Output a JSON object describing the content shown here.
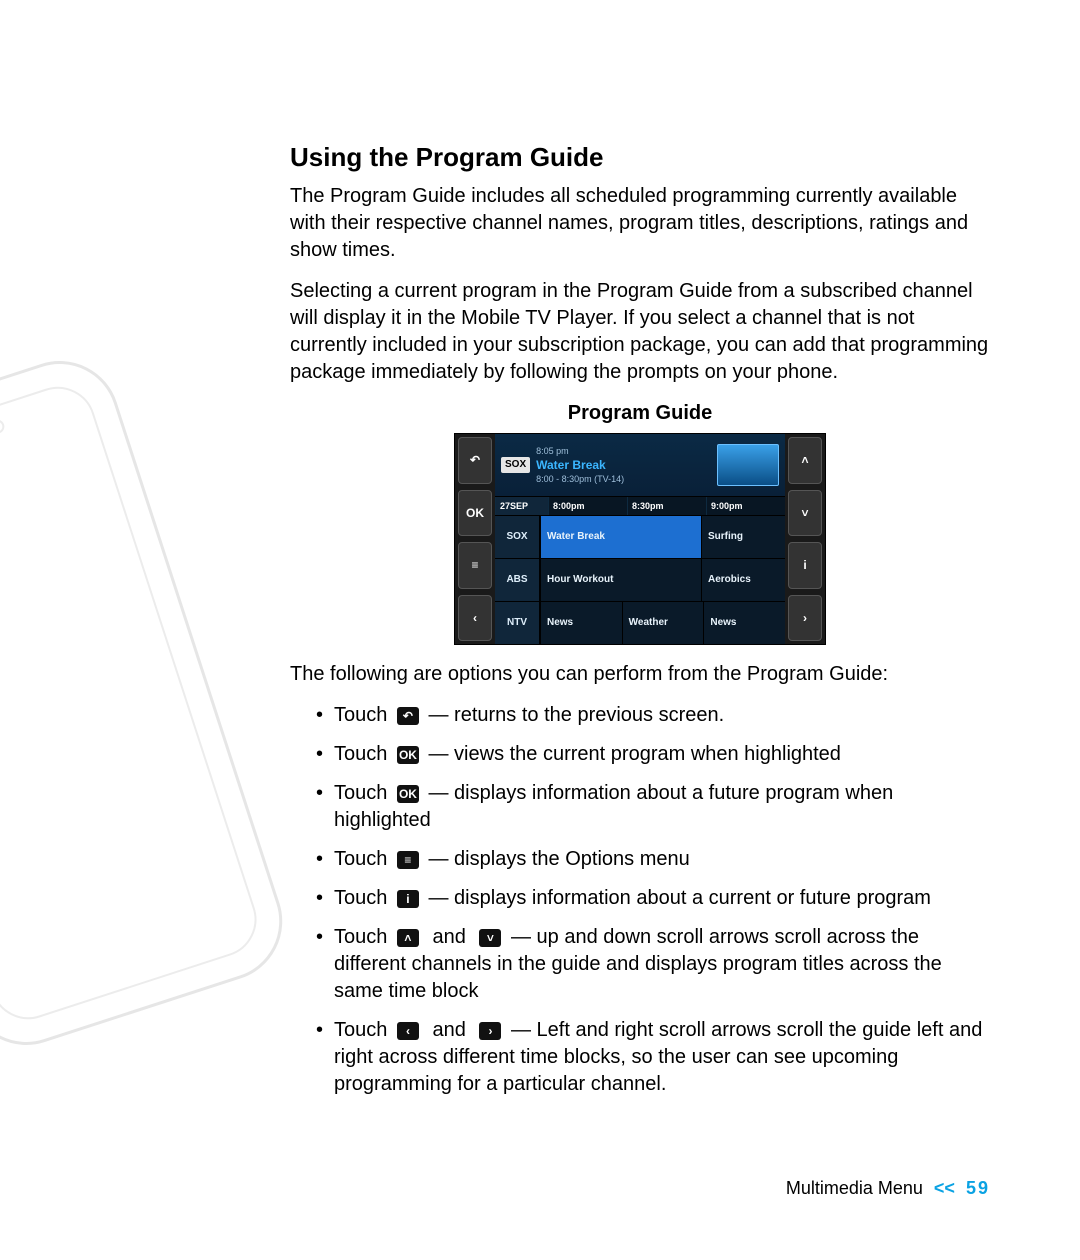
{
  "heading": "Using the Program Guide",
  "para1": "The Program Guide includes all scheduled programming currently available with their respective channel names, program titles, descriptions, ratings and show times.",
  "para2": "Selecting a current program in the Program Guide from a subscribed channel will display it in the Mobile TV Player.  If you select a channel that is not currently included in your subscription package, you can add that programming package immediately by following the prompts on your phone.",
  "caption": "Program Guide",
  "screenshot": {
    "clock": "8:05 pm",
    "channel_tag": "SOX",
    "title": "Water Break",
    "subtitle": "8:00 - 8:30pm (TV-14)",
    "date_label": "27SEP",
    "times": [
      "8:00pm",
      "8:30pm",
      "9:00pm"
    ],
    "left_buttons": [
      "↶",
      "OK",
      "≡",
      "‹"
    ],
    "right_buttons": [
      "˄",
      "˅",
      "i",
      "›"
    ],
    "rows": [
      {
        "ch": "SOX",
        "cells": [
          "Water Break",
          "Surfing"
        ],
        "selected": 0
      },
      {
        "ch": "ABS",
        "cells": [
          "Hour Workout",
          "Aerobics"
        ]
      },
      {
        "ch": "NTV",
        "cells": [
          "News",
          "Weather",
          "News"
        ]
      }
    ]
  },
  "options_intro": "The following are options you can perform from the Program Guide:",
  "touch_word": "Touch",
  "and_word": "and",
  "bullets": {
    "b1": " — returns to the previous screen.",
    "b2": " — views the current program when highlighted",
    "b3": " — displays information about a future program when highlighted",
    "b4": " — displays the Options menu",
    "b5": " — displays information about a current or future program",
    "b6": " — up and down scroll arrows scroll across the different channels in the guide and displays program titles across the same time block",
    "b7": " — Left and right scroll arrows scroll the guide left and right across different time blocks, so the user can see upcoming programming for a particular channel."
  },
  "icons": {
    "back": "↶",
    "ok": "OK",
    "menu": "≡",
    "info": "i",
    "up": "˄",
    "down": "˅",
    "left": "‹",
    "right": "›"
  },
  "footer": {
    "section": "Multimedia Menu",
    "sep": "<<",
    "page": "59"
  }
}
